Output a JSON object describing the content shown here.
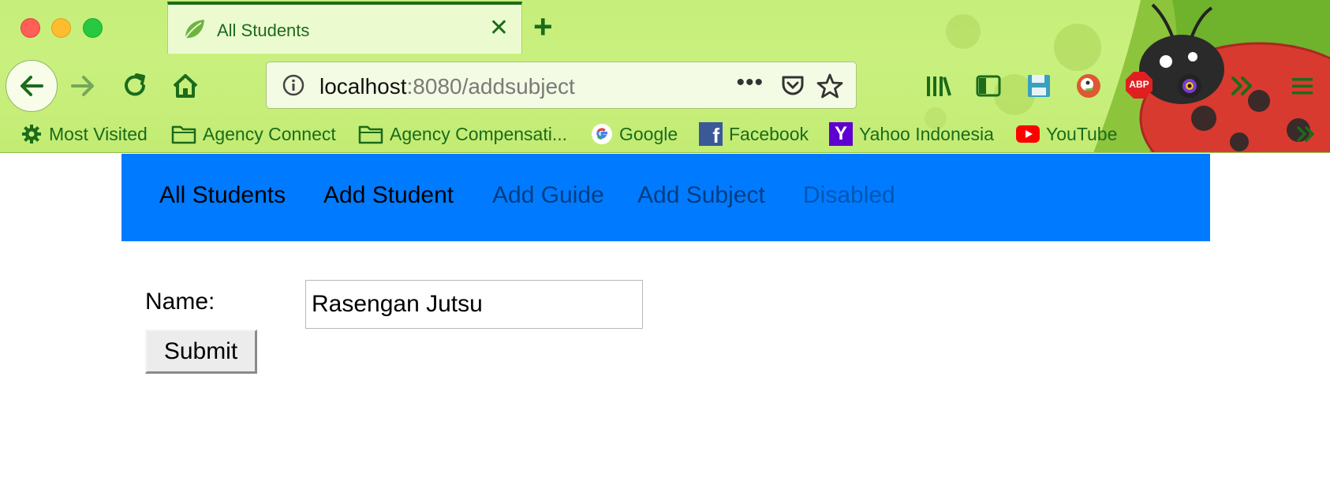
{
  "browser": {
    "tab_title": "All Students",
    "tab_close": "✕",
    "new_tab": "+",
    "url_host": "localhost",
    "url_rest": ":8080/addsubject",
    "url_more": "•••",
    "overflow": "»",
    "bookmarks": [
      {
        "label": "Most Visited",
        "icon": "gear-icon"
      },
      {
        "label": "Agency Connect",
        "icon": "folder-icon"
      },
      {
        "label": "Agency Compensati...",
        "icon": "folder-icon"
      },
      {
        "label": "Google",
        "icon": "google-icon"
      },
      {
        "label": "Facebook",
        "icon": "facebook-icon"
      },
      {
        "label": "Yahoo Indonesia",
        "icon": "yahoo-icon"
      },
      {
        "label": "YouTube",
        "icon": "youtube-icon"
      }
    ],
    "extensions": {
      "abp": "ABP",
      "fb_letter": "f",
      "yahoo_letter": "Y"
    }
  },
  "colors": {
    "chrome_green": "#c6ee7a",
    "chrome_text": "#1b6b1b",
    "navbar_bg": "#007bff"
  },
  "navbar": {
    "links": [
      {
        "label": "All Students",
        "state": "active"
      },
      {
        "label": "Add Student",
        "state": "active"
      },
      {
        "label": "Add Guide",
        "state": "normal"
      },
      {
        "label": "Add Subject",
        "state": "normal"
      },
      {
        "label": "Disabled",
        "state": "disabled"
      }
    ]
  },
  "form": {
    "name_label": "Name:",
    "name_value": "Rasengan Jutsu",
    "submit_label": "Submit"
  }
}
